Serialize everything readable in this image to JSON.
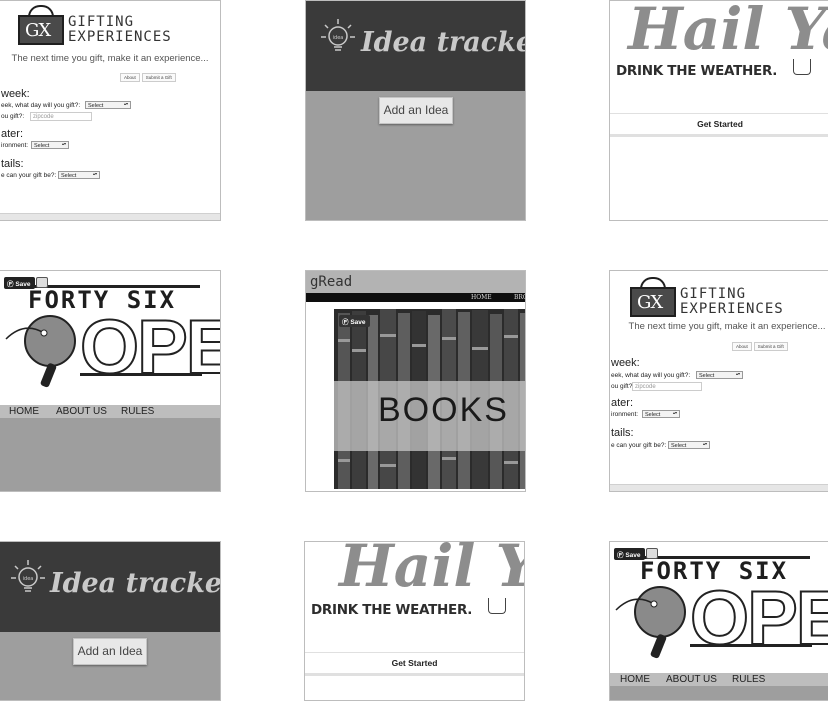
{
  "gifting": {
    "logo_box": "GX",
    "logo_line1": "GIFTING",
    "logo_line2": "EXPERIENCES",
    "tagline": "The next time you gift, make it an experience...",
    "about_btn": "About",
    "submit_btn": "Submit a Gift",
    "section_week": "week:",
    "label_day": "eek, what day will you gift?:",
    "label_where": "ou gift?:",
    "zip_placeholder": "zipcode",
    "section_weather": "ater:",
    "label_env": "ironment:",
    "section_details": "tails:",
    "label_gift": "e can your gift be?:",
    "select_value": "Select"
  },
  "idea": {
    "title": "Idea tracker",
    "bulb_text": "idea",
    "add_button": "Add an Idea"
  },
  "hail": {
    "script": "Hail Ya",
    "tagline": "DRINK THE WEATHER.",
    "get_started": "Get Started"
  },
  "forty": {
    "save_label": "Save",
    "title_top": "FORTY SIX",
    "title_main": "OPEN",
    "nav": [
      "HOME",
      "ABOUT US",
      "RULES"
    ]
  },
  "gread": {
    "title": "gRead",
    "nav_home": "HOME",
    "nav_browse": "BRO",
    "save_label": "Save",
    "banner": "BOOKS"
  }
}
